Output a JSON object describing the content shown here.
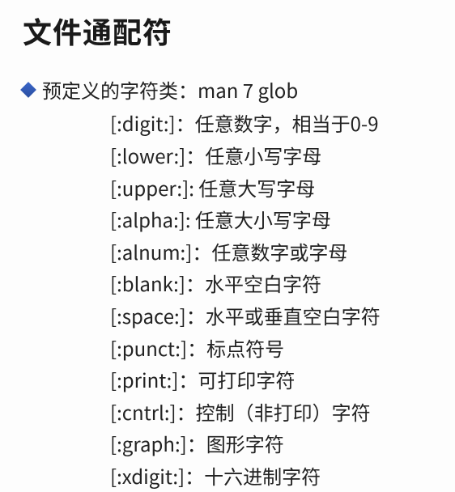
{
  "title": "文件通配符",
  "section_intro": "预定义的字符类：man 7 glob",
  "items": [
    "[:digit:]：任意数字，相当于0-9",
    "[:lower:]：任意小写字母",
    "[:upper:]: 任意大写字母",
    "[:alpha:]: 任意大小写字母",
    "[:alnum:]：任意数字或字母",
    "[:blank:]：水平空白字符",
    "[:space:]：水平或垂直空白字符",
    "[:punct:]：标点符号",
    "[:print:]：可打印字符",
    "[:cntrl:]：控制（非打印）字符",
    "[:graph:]：图形字符",
    "[:xdigit:]：十六进制字符"
  ]
}
